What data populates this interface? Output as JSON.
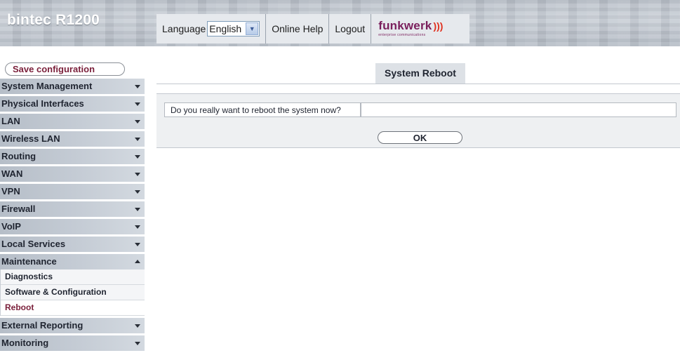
{
  "header": {
    "brand": "bintec R1200",
    "language_label": "Language",
    "language_value": "English",
    "online_help": "Online Help",
    "logout": "Logout",
    "logo_text": "funkwerk",
    "logo_sub": "enterprise communications",
    "logo_color": "#7a1f5c"
  },
  "sidebar": {
    "save_label": "Save configuration",
    "items": [
      {
        "label": "System Management",
        "chevron": "down"
      },
      {
        "label": "Physical Interfaces",
        "chevron": "down"
      },
      {
        "label": "LAN",
        "chevron": "down"
      },
      {
        "label": "Wireless LAN",
        "chevron": "down"
      },
      {
        "label": "Routing",
        "chevron": "down"
      },
      {
        "label": "WAN",
        "chevron": "down"
      },
      {
        "label": "VPN",
        "chevron": "down"
      },
      {
        "label": "Firewall",
        "chevron": "down"
      },
      {
        "label": "VoIP",
        "chevron": "down"
      },
      {
        "label": "Local Services",
        "chevron": "down"
      },
      {
        "label": "Maintenance",
        "chevron": "up"
      },
      {
        "label": "External Reporting",
        "chevron": "down"
      },
      {
        "label": "Monitoring",
        "chevron": "down"
      }
    ],
    "maintenance_sub": [
      {
        "label": "Diagnostics",
        "active": false
      },
      {
        "label": "Software & Configuration",
        "active": false
      },
      {
        "label": "Reboot",
        "active": true
      }
    ]
  },
  "main": {
    "title": "System Reboot",
    "question": "Do you really want to reboot the system now?",
    "ok_label": "OK"
  }
}
